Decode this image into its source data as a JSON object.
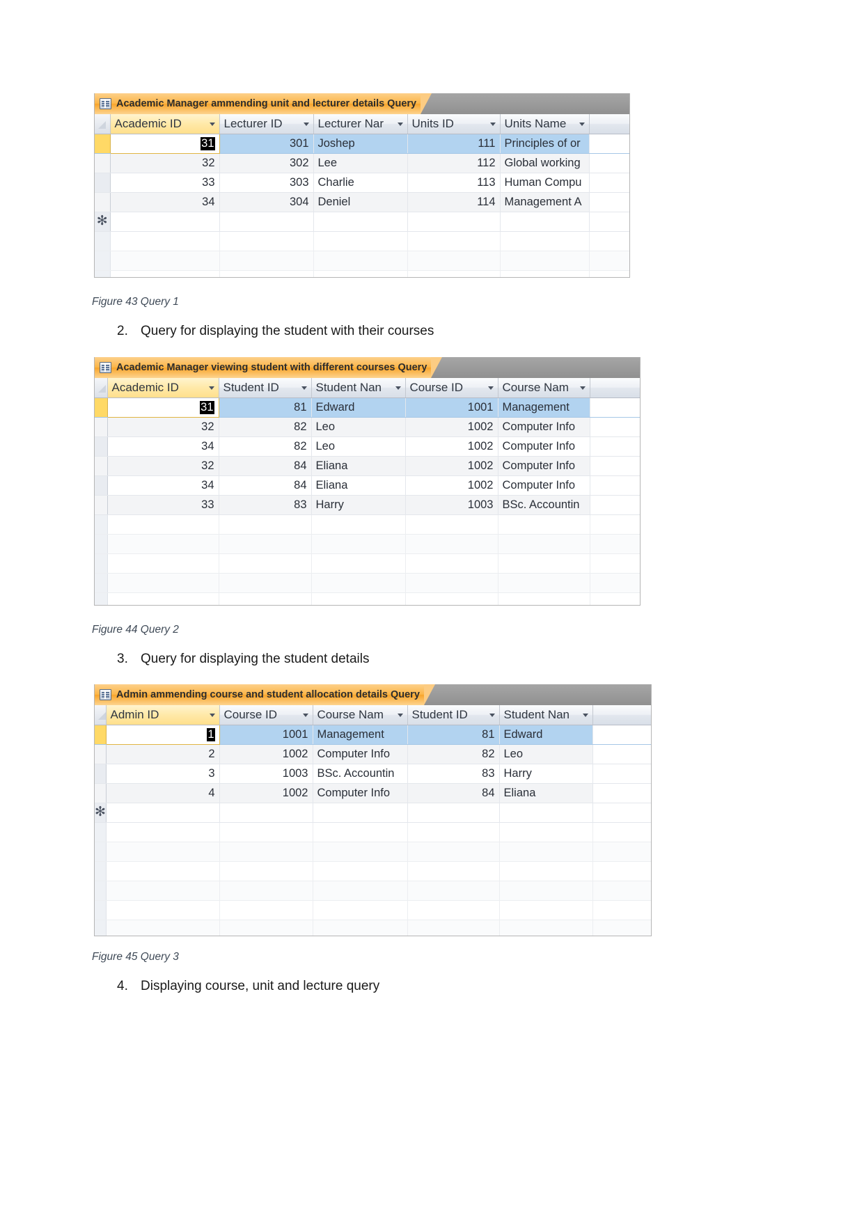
{
  "document": {
    "captions": [
      {
        "id": "fig43",
        "text": "Figure 43 Query 1"
      },
      {
        "id": "fig44",
        "text": "Figure 44 Query 2"
      },
      {
        "id": "fig45",
        "text": "Figure 45 Query 3"
      }
    ],
    "list_items": [
      {
        "number": "2.",
        "text": "Query for displaying the student with their courses"
      },
      {
        "number": "3.",
        "text": "Query for displaying the student details"
      },
      {
        "number": "4.",
        "text": "Displaying course, unit and lecture query"
      }
    ]
  },
  "query1": {
    "tab_title": "Academic Manager ammending unit and lecturer details Query",
    "tab_icon": "query-datasheet-icon",
    "columns": [
      {
        "label": "Academic ID",
        "selected": true
      },
      {
        "label": "Lecturer ID",
        "selected": false
      },
      {
        "label": "Lecturer Nar",
        "selected": false
      },
      {
        "label": "Units ID",
        "selected": false
      },
      {
        "label": "Units Name",
        "selected": false
      }
    ],
    "rows": [
      {
        "selector": "",
        "academic_id": "31",
        "lecturer_id": "301",
        "lecturer_name": "Joshep",
        "units_id": "111",
        "units_name": "Principles of or"
      },
      {
        "selector": "",
        "academic_id": "32",
        "lecturer_id": "302",
        "lecturer_name": "Lee",
        "units_id": "112",
        "units_name": "Global working"
      },
      {
        "selector": "",
        "academic_id": "33",
        "lecturer_id": "303",
        "lecturer_name": "Charlie",
        "units_id": "113",
        "units_name": "Human Compu"
      },
      {
        "selector": "",
        "academic_id": "34",
        "lecturer_id": "304",
        "lecturer_name": "Deniel",
        "units_id": "114",
        "units_name": "Management A"
      }
    ],
    "new_row_marker": "✻"
  },
  "query2": {
    "tab_title": "Academic Manager viewing student with different courses Query",
    "tab_icon": "query-datasheet-icon",
    "columns": [
      {
        "label": "Academic ID",
        "selected": true
      },
      {
        "label": "Student ID",
        "selected": false
      },
      {
        "label": "Student Nan",
        "selected": false
      },
      {
        "label": "Course ID",
        "selected": false
      },
      {
        "label": "Course Nam",
        "selected": false
      }
    ],
    "rows": [
      {
        "academic_id": "31",
        "student_id": "81",
        "student_name": "Edward",
        "course_id": "1001",
        "course_name": "Management"
      },
      {
        "academic_id": "32",
        "student_id": "82",
        "student_name": "Leo",
        "course_id": "1002",
        "course_name": "Computer Info"
      },
      {
        "academic_id": "34",
        "student_id": "82",
        "student_name": "Leo",
        "course_id": "1002",
        "course_name": "Computer Info"
      },
      {
        "academic_id": "32",
        "student_id": "84",
        "student_name": "Eliana",
        "course_id": "1002",
        "course_name": "Computer Info"
      },
      {
        "academic_id": "34",
        "student_id": "84",
        "student_name": "Eliana",
        "course_id": "1002",
        "course_name": "Computer Info"
      },
      {
        "academic_id": "33",
        "student_id": "83",
        "student_name": "Harry",
        "course_id": "1003",
        "course_name": "BSc. Accountin"
      }
    ]
  },
  "query3": {
    "tab_title": "Admin ammending course and student allocation details Query",
    "tab_icon": "query-datasheet-icon",
    "columns": [
      {
        "label": "Admin ID",
        "selected": true
      },
      {
        "label": "Course ID",
        "selected": false
      },
      {
        "label": "Course Nam",
        "selected": false
      },
      {
        "label": "Student ID",
        "selected": false
      },
      {
        "label": "Student Nan",
        "selected": false
      }
    ],
    "rows": [
      {
        "admin_id": "1",
        "course_id": "1001",
        "course_name": "Management",
        "student_id": "81",
        "student_name": "Edward"
      },
      {
        "admin_id": "2",
        "course_id": "1002",
        "course_name": "Computer Info",
        "student_id": "82",
        "student_name": "Leo"
      },
      {
        "admin_id": "3",
        "course_id": "1003",
        "course_name": "BSc. Accountin",
        "student_id": "83",
        "student_name": "Harry"
      },
      {
        "admin_id": "4",
        "course_id": "1002",
        "course_name": "Computer Info",
        "student_id": "84",
        "student_name": "Eliana"
      }
    ],
    "new_row_marker": "✻"
  },
  "colors": {
    "tab_orange": "#f8a52c",
    "tab_bar_gray": "#9a9a9a",
    "selected_row_blue": "#b2d3f0",
    "selected_header_yellow": "#ffdf8c",
    "row_selector_gold": "#ffd966"
  }
}
